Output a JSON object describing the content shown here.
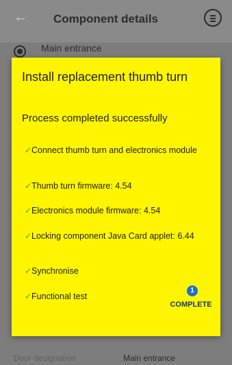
{
  "appbar": {
    "title": "Component details",
    "back_icon": "arrow-back-icon",
    "menu_icon": "list-menu-icon"
  },
  "background": {
    "radio_label": "Main entrance",
    "door_designation_label": "Door designation",
    "door_designation_value": "Main entrance"
  },
  "dialog": {
    "title": "Install replacement thumb turn",
    "subtitle": "Process completed successfully",
    "background_color": "#fff500",
    "check_color": "#3aa845",
    "steps": [
      {
        "label": "Connect thumb turn and electronics module"
      },
      {
        "label": "Thumb turn firmware: 4.54"
      },
      {
        "label": "Electronics module firmware: 4.54"
      },
      {
        "label": "Locking component Java Card applet: 6.44"
      },
      {
        "label": "Synchronise"
      },
      {
        "label": "Functional test"
      }
    ],
    "badge_count": "1",
    "complete_label": "COMPLETE"
  }
}
